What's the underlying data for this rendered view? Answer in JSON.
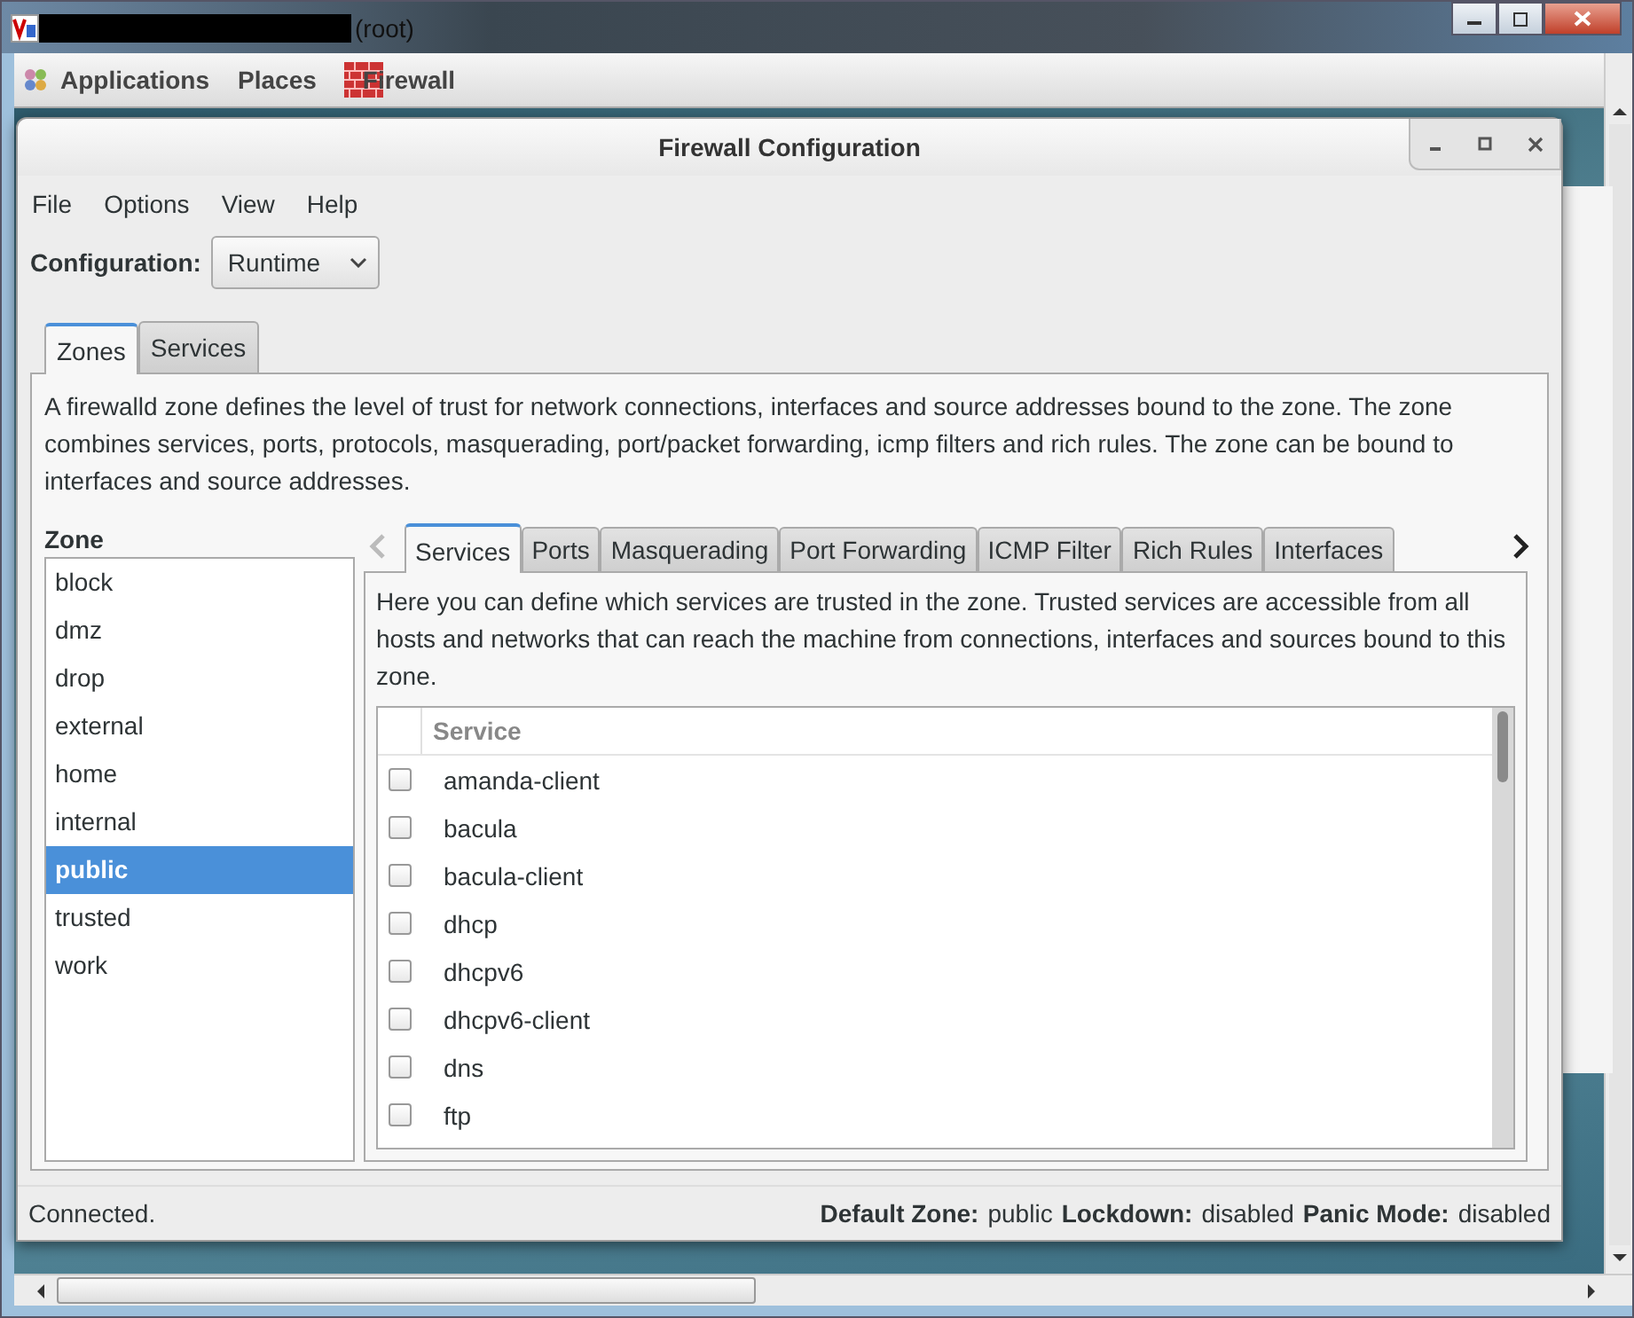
{
  "outer_window": {
    "title": "(root)"
  },
  "panel": {
    "items": [
      "Applications",
      "Places",
      "Firewall"
    ]
  },
  "window": {
    "title": "Firewall Configuration"
  },
  "menu": [
    "File",
    "Options",
    "View",
    "Help"
  ],
  "configuration": {
    "label": "Configuration:",
    "value": "Runtime"
  },
  "tabs": [
    {
      "label": "Zones",
      "selected": true
    },
    {
      "label": "Services",
      "selected": false
    }
  ],
  "description": "A firewalld zone defines the level of trust for network connections, interfaces and source addresses bound to the zone. The zone combines services, ports, protocols, masquerading, port/packet forwarding, icmp filters and rich rules. The zone can be bound to interfaces and source addresses.",
  "zone_list": {
    "heading": "Zone",
    "items": [
      {
        "label": "block",
        "selected": false
      },
      {
        "label": "dmz",
        "selected": false
      },
      {
        "label": "drop",
        "selected": false
      },
      {
        "label": "external",
        "selected": false
      },
      {
        "label": "home",
        "selected": false
      },
      {
        "label": "internal",
        "selected": false
      },
      {
        "label": "public",
        "selected": true
      },
      {
        "label": "trusted",
        "selected": false
      },
      {
        "label": "work",
        "selected": false
      }
    ]
  },
  "zone_tabs": [
    {
      "label": "Services",
      "selected": true
    },
    {
      "label": "Ports",
      "selected": false
    },
    {
      "label": "Masquerading",
      "selected": false
    },
    {
      "label": "Port Forwarding",
      "selected": false
    },
    {
      "label": "ICMP Filter",
      "selected": false
    },
    {
      "label": "Rich Rules",
      "selected": false
    },
    {
      "label": "Interfaces",
      "selected": false
    }
  ],
  "services_description": "Here you can define which services are trusted in the zone. Trusted services are accessible from all hosts and networks that can reach the machine from connections, interfaces and sources bound to this zone.",
  "services_table": {
    "column": "Service",
    "rows": [
      {
        "name": "amanda-client",
        "checked": false
      },
      {
        "name": "bacula",
        "checked": false
      },
      {
        "name": "bacula-client",
        "checked": false
      },
      {
        "name": "dhcp",
        "checked": false
      },
      {
        "name": "dhcpv6",
        "checked": false
      },
      {
        "name": "dhcpv6-client",
        "checked": false
      },
      {
        "name": "dns",
        "checked": false
      },
      {
        "name": "ftp",
        "checked": false
      }
    ]
  },
  "status_bar": {
    "message": "Connected.",
    "fields": [
      {
        "label": "Default Zone:",
        "value": "public"
      },
      {
        "label": "Lockdown:",
        "value": "disabled"
      },
      {
        "label": "Panic Mode:",
        "value": "disabled"
      }
    ]
  }
}
